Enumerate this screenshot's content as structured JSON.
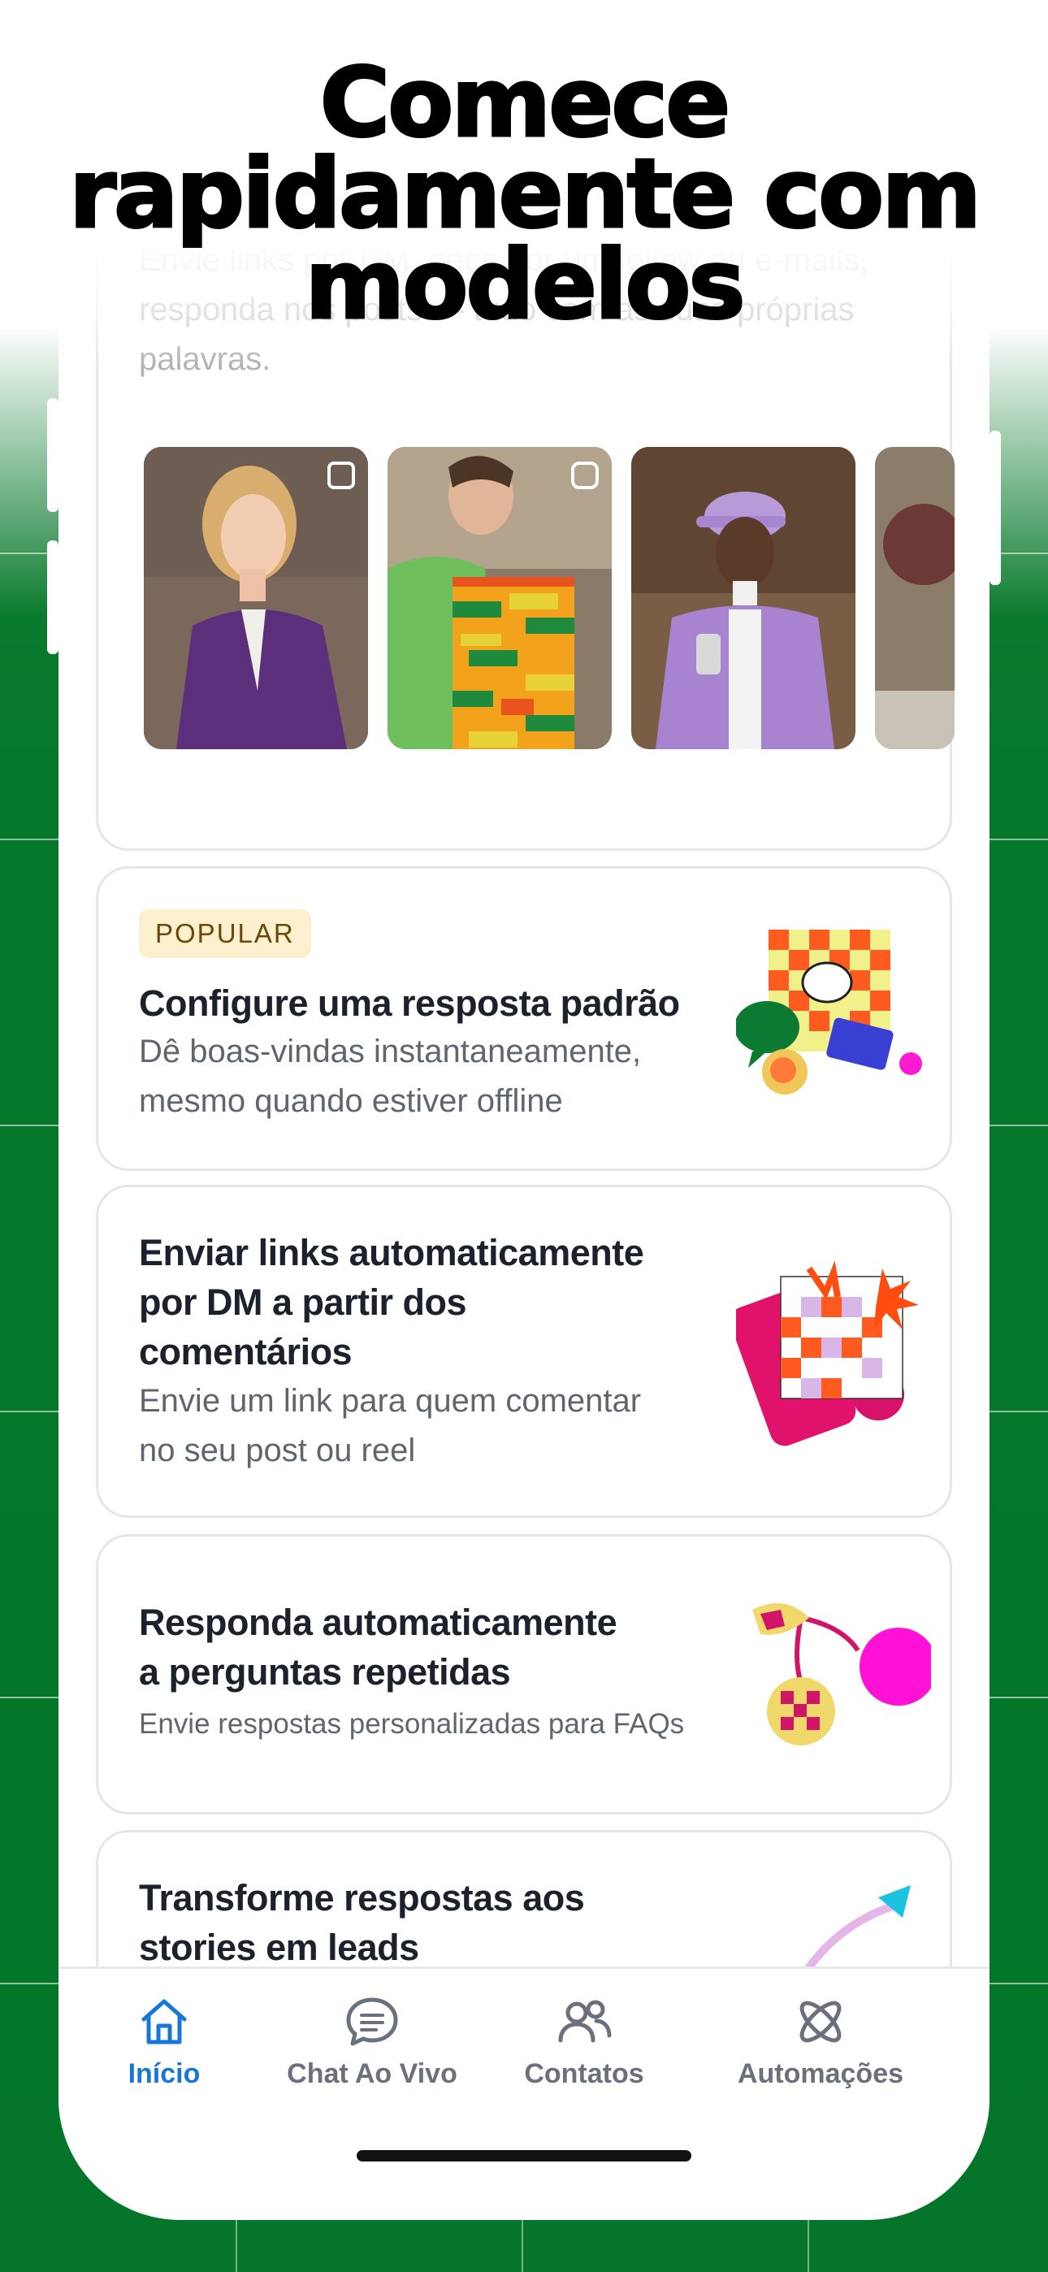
{
  "promo": {
    "headline_line1": "Comece",
    "headline_line2": "rapidamente com",
    "headline_line3": "modelos"
  },
  "template_card_top": {
    "description": "Envie links por DM, peça por um follow ou e-mails, responda nos posts — tudo com as suas próprias palavras.",
    "thumbnails": [
      {
        "name": "woman-purple-blazer",
        "icon": "carousel-icon"
      },
      {
        "name": "man-stacking-blocks",
        "icon": "reels-icon"
      },
      {
        "name": "man-purple-cap-phone",
        "icon": ""
      },
      {
        "name": "partial-thumbnail",
        "icon": ""
      }
    ]
  },
  "templates": [
    {
      "badge": "POPULAR",
      "title": "Configure uma resposta padrão",
      "subtitle_line1": "Dê boas-vindas instantaneamente,",
      "subtitle_line2": "mesmo quando estiver offline"
    },
    {
      "title_line1": "Enviar links automaticamente",
      "title_line2": "por DM a partir dos",
      "title_line3": "comentários",
      "subtitle_line1": "Envie um link para quem comentar",
      "subtitle_line2": "no seu post ou reel"
    },
    {
      "title_line1": "Responda automaticamente",
      "title_line2": "a perguntas repetidas",
      "subtitle": "Envie respostas personalizadas para FAQs"
    },
    {
      "title_line1": "Transforme respostas aos",
      "title_line2": "stories em leads"
    }
  ],
  "tabbar": {
    "items": [
      {
        "label": "Início",
        "icon": "home-icon",
        "active": true
      },
      {
        "label": "Chat Ao Vivo",
        "icon": "chat-bubble-icon",
        "active": false
      },
      {
        "label": "Contatos",
        "icon": "contacts-icon",
        "active": false
      },
      {
        "label": "Automações",
        "icon": "automation-atom-icon",
        "active": false
      }
    ]
  },
  "colors": {
    "background_green": "#05782b",
    "accent_blue": "#1877d6",
    "badge_bg": "#fcf0cf",
    "badge_text": "#6b4708"
  }
}
